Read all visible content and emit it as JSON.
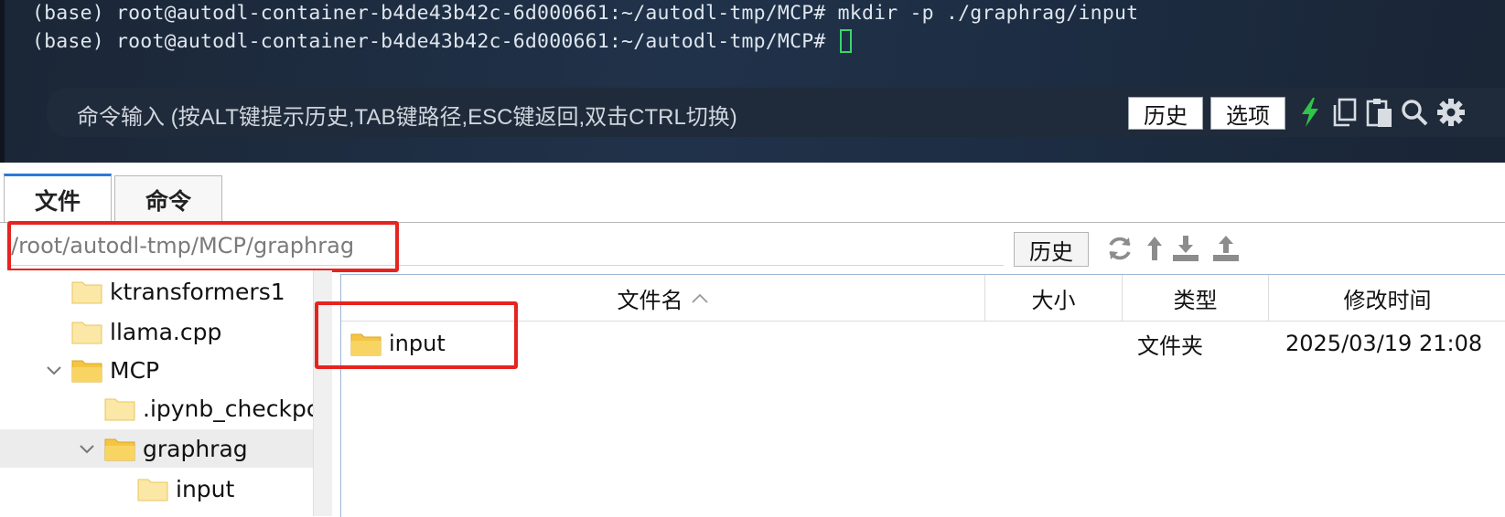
{
  "terminal": {
    "lines": [
      "(base) root@autodl-container-b4de43b42c-6d000661:~/autodl-tmp/MCP# mkdir -p ./graphrag/input",
      "(base) root@autodl-container-b4de43b42c-6d000661:~/autodl-tmp/MCP# "
    ],
    "cursor_color": "#3bd56a"
  },
  "command_bar": {
    "placeholder": "命令输入 (按ALT键提示历史,TAB键路径,ESC键返回,双击CTRL切换)",
    "history_label": "历史",
    "options_label": "选项",
    "icons": [
      "lightning-icon",
      "copy-icon",
      "paste-icon",
      "search-icon",
      "gear-icon"
    ]
  },
  "tabs": [
    {
      "label": "文件",
      "active": true
    },
    {
      "label": "命令",
      "active": false
    }
  ],
  "path_bar": {
    "value": "/root/autodl-tmp/MCP/graphrag",
    "history_label": "历史",
    "icons": [
      "refresh-icon",
      "up-arrow-icon",
      "download-icon",
      "upload-icon"
    ]
  },
  "tree": {
    "items": [
      {
        "label": "ktransformers1",
        "expanded": null,
        "selected": false
      },
      {
        "label": "llama.cpp",
        "expanded": null,
        "selected": false
      },
      {
        "label": "MCP",
        "expanded": true,
        "selected": false
      },
      {
        "label": ".ipynb_checkpc",
        "expanded": null,
        "selected": false
      },
      {
        "label": "graphrag",
        "expanded": true,
        "selected": true
      },
      {
        "label": "input",
        "expanded": null,
        "selected": false
      }
    ]
  },
  "file_list": {
    "columns": [
      "文件名",
      "大小",
      "类型",
      "修改时间"
    ],
    "sorted_column": "文件名",
    "rows": [
      {
        "name": "input",
        "size": "",
        "type": "文件夹",
        "modified": "2025/03/19 21:08"
      }
    ]
  },
  "colors": {
    "highlight_box": "#e52420",
    "folder": "#f5c542",
    "active_tab_accent": "#2a7ad9",
    "lightning": "#2fc44a"
  }
}
